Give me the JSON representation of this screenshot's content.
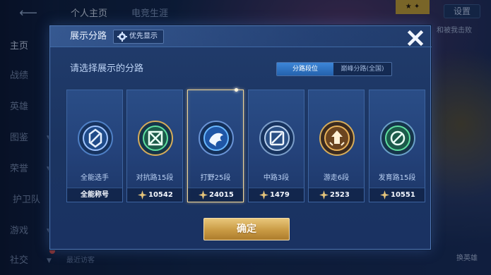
{
  "background": {
    "nav": [
      {
        "label": "主页"
      },
      {
        "label": "战绩"
      },
      {
        "label": "英雄"
      },
      {
        "label": "图鉴"
      },
      {
        "label": "荣誉"
      },
      {
        "label": "护卫队"
      },
      {
        "label": "游戏"
      },
      {
        "label": "社交"
      }
    ],
    "top_tabs": [
      "个人主页",
      "电竞生涯"
    ],
    "settings_label": "设置",
    "right_label": "和被我击败",
    "right_bottom_label": "换英雄",
    "bottom_label": "最近访客"
  },
  "modal": {
    "title": "展示分路",
    "priority_label": "优先显示",
    "subtitle": "请选择展示的分路",
    "tabs": [
      {
        "label": "分路段位",
        "active": true
      },
      {
        "label": "巅峰分路(全国)",
        "active": false
      }
    ],
    "confirm_label": "确定",
    "cards": [
      {
        "role": "全能选手",
        "value": "全能称号",
        "icon": "all-round-badge-icon",
        "color": "#9fc4ff",
        "selected": false,
        "has_star": false
      },
      {
        "role": "对抗路15段",
        "value": "10542",
        "icon": "clash-lane-badge-icon",
        "color": "#5fe0a0",
        "selected": false,
        "has_star": true
      },
      {
        "role": "打野25段",
        "value": "24015",
        "icon": "jungle-badge-icon",
        "color": "#6ab8ff",
        "selected": true,
        "has_star": true
      },
      {
        "role": "中路3段",
        "value": "1479",
        "icon": "mid-lane-badge-icon",
        "color": "#b8d0ee",
        "selected": false,
        "has_star": true
      },
      {
        "role": "游走6段",
        "value": "2523",
        "icon": "roam-badge-icon",
        "color": "#e8b25a",
        "selected": false,
        "has_star": true
      },
      {
        "role": "发育路15段",
        "value": "10551",
        "icon": "farm-lane-badge-icon",
        "color": "#5fe0a0",
        "selected": false,
        "has_star": true
      }
    ]
  },
  "colors": {
    "accent_blue": "#2f75c8",
    "gold": "#d6ac5a",
    "selected_border": "#f0d79a"
  }
}
